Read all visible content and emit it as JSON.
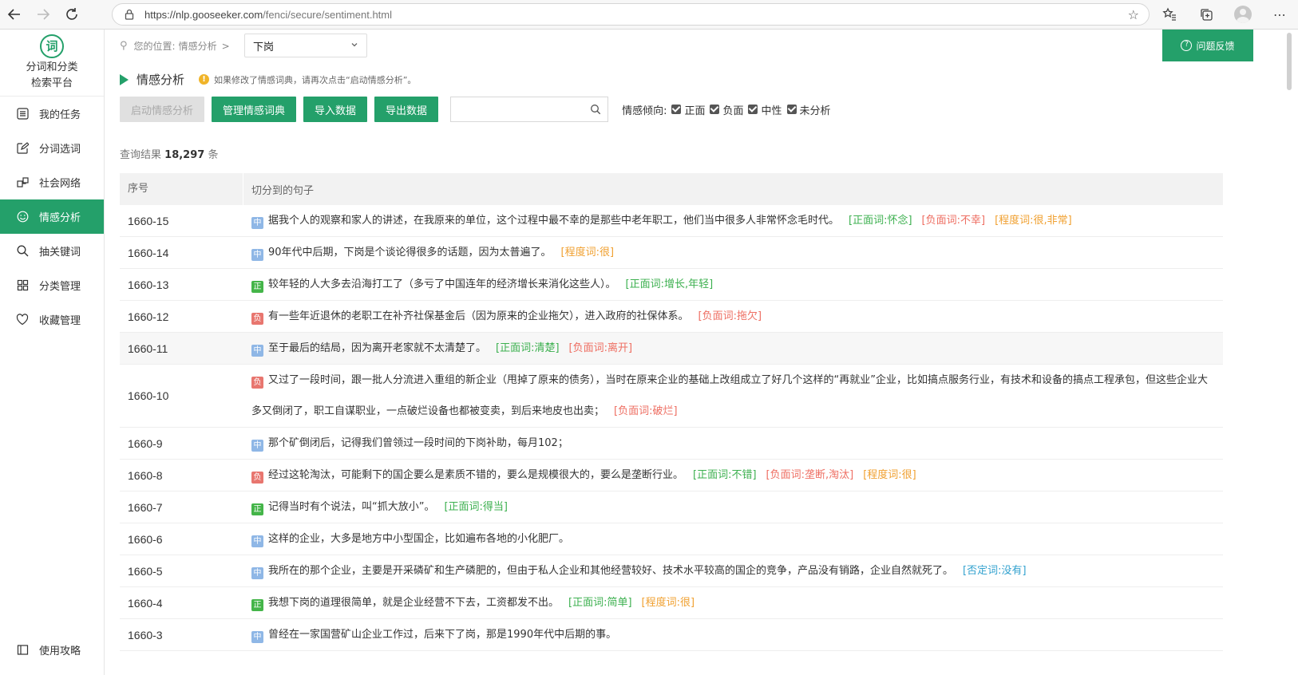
{
  "browser": {
    "url_host": "https://nlp.gooseeker.com",
    "url_path": "/fenci/secure/sentiment.html"
  },
  "sidebar": {
    "logo_char": "词",
    "logo_line1": "分词和分类",
    "logo_line2": "检索平台",
    "items": [
      {
        "label": "我的任务",
        "icon": "task-list-icon"
      },
      {
        "label": "分词选词",
        "icon": "edit-icon"
      },
      {
        "label": "社会网络",
        "icon": "network-icon"
      },
      {
        "label": "情感分析",
        "icon": "smile-icon",
        "active": true
      },
      {
        "label": "抽关键词",
        "icon": "search-icon"
      },
      {
        "label": "分类管理",
        "icon": "grid-icon"
      },
      {
        "label": "收藏管理",
        "icon": "heart-icon"
      }
    ],
    "bottom_label": "使用攻略"
  },
  "breadcrumb": {
    "prefix": "您的位置:",
    "page": "情感分析",
    "separator": ">"
  },
  "topic_select": {
    "value": "下岗"
  },
  "section": {
    "title": "情感分析",
    "hint": "如果修改了情感词典，请再次点击“启动情感分析”。"
  },
  "toolbar": {
    "start_label": "启动情感分析",
    "manage_label": "管理情感词典",
    "import_label": "导入数据",
    "export_label": "导出数据",
    "search_placeholder": "",
    "filter_label": "情感倾向:",
    "filters": [
      "正面",
      "负面",
      "中性",
      "未分析"
    ]
  },
  "results": {
    "prefix": "查询结果",
    "count": "18,297",
    "suffix": "条"
  },
  "table": {
    "col_id": "序号",
    "col_sentence": "切分到的句子",
    "rows": [
      {
        "id": "1660-15",
        "tag": "中",
        "cls": "zhong",
        "text": "据我个人的观察和家人的讲述，在我原来的单位，这个过程中最不幸的是那些中老年职工，他们当中很多人非常怀念毛时代。",
        "kws": [
          {
            "t": "[正面词:怀念]",
            "c": "pos"
          },
          {
            "t": "[负面词:不幸]",
            "c": "neg"
          },
          {
            "t": "[程度词:很,非常]",
            "c": "deg"
          }
        ]
      },
      {
        "id": "1660-14",
        "tag": "中",
        "cls": "zhong",
        "text": "90年代中后期，下岗是个谈论得很多的话题，因为太普遍了。",
        "kws": [
          {
            "t": "[程度词:很]",
            "c": "deg"
          }
        ]
      },
      {
        "id": "1660-13",
        "tag": "正",
        "cls": "zheng",
        "text": "较年轻的人大多去沿海打工了（多亏了中国连年的经济增长来消化这些人）。",
        "kws": [
          {
            "t": "[正面词:增长,年轻]",
            "c": "pos"
          }
        ]
      },
      {
        "id": "1660-12",
        "tag": "负",
        "cls": "fu",
        "text": "有一些年近退休的老职工在补齐社保基金后（因为原来的企业拖欠），进入政府的社保体系。",
        "kws": [
          {
            "t": "[负面词:拖欠]",
            "c": "neg"
          }
        ]
      },
      {
        "id": "1660-11",
        "tag": "中",
        "cls": "zhong",
        "text": "至于最后的结局，因为离开老家就不太清楚了。",
        "kws": [
          {
            "t": "[正面词:清楚]",
            "c": "pos"
          },
          {
            "t": "[负面词:离开]",
            "c": "neg"
          }
        ],
        "hl": true
      },
      {
        "id": "1660-10",
        "tag": "负",
        "cls": "fu",
        "text": "又过了一段时间，跟一批人分流进入重组的新企业（甩掉了原来的债务），当时在原来企业的基础上改组成立了好几个这样的“再就业”企业，比如搞点服务行业，有技术和设备的搞点工程承包，但这些企业大多又倒闭了，职工自谋职业，一点破烂设备也都被变卖，到后来地皮也出卖；",
        "kws": [
          {
            "t": "[负面词:破烂]",
            "c": "neg"
          }
        ]
      },
      {
        "id": "1660-9",
        "tag": "中",
        "cls": "zhong",
        "text": "那个矿倒闭后，记得我们曾领过一段时间的下岗补助，每月102；",
        "kws": []
      },
      {
        "id": "1660-8",
        "tag": "负",
        "cls": "fu",
        "text": "经过这轮淘汰，可能剩下的国企要么是素质不错的，要么是规模很大的，要么是垄断行业。",
        "kws": [
          {
            "t": "[正面词:不错]",
            "c": "pos"
          },
          {
            "t": "[负面词:垄断,淘汰]",
            "c": "neg"
          },
          {
            "t": "[程度词:很]",
            "c": "deg"
          }
        ]
      },
      {
        "id": "1660-7",
        "tag": "正",
        "cls": "zheng",
        "text": "记得当时有个说法，叫“抓大放小”。",
        "kws": [
          {
            "t": "[正面词:得当]",
            "c": "pos"
          }
        ]
      },
      {
        "id": "1660-6",
        "tag": "中",
        "cls": "zhong",
        "text": "这样的企业，大多是地方中小型国企，比如遍布各地的小化肥厂。",
        "kws": []
      },
      {
        "id": "1660-5",
        "tag": "中",
        "cls": "zhong",
        "text": "我所在的那个企业，主要是开采磷矿和生产磷肥的，但由于私人企业和其他经营较好、技术水平较高的国企的竞争，产品没有销路，企业自然就死了。",
        "kws": [
          {
            "t": "[否定词:没有]",
            "c": "negt"
          }
        ]
      },
      {
        "id": "1660-4",
        "tag": "正",
        "cls": "zheng",
        "text": "我想下岗的道理很简单，就是企业经营不下去，工资都发不出。",
        "kws": [
          {
            "t": "[正面词:简单]",
            "c": "pos"
          },
          {
            "t": "[程度词:很]",
            "c": "deg"
          }
        ]
      },
      {
        "id": "1660-3",
        "tag": "中",
        "cls": "zhong",
        "text": "曾经在一家国营矿山企业工作过，后来下了岗，那是1990年代中后期的事。",
        "kws": []
      }
    ]
  },
  "feedback": {
    "label": "问题反馈"
  },
  "colors": {
    "accent": "#24a06a",
    "positive": "#3cb04f",
    "negative": "#ee6e62",
    "degree": "#f0a030",
    "negation": "#33a2cf"
  }
}
